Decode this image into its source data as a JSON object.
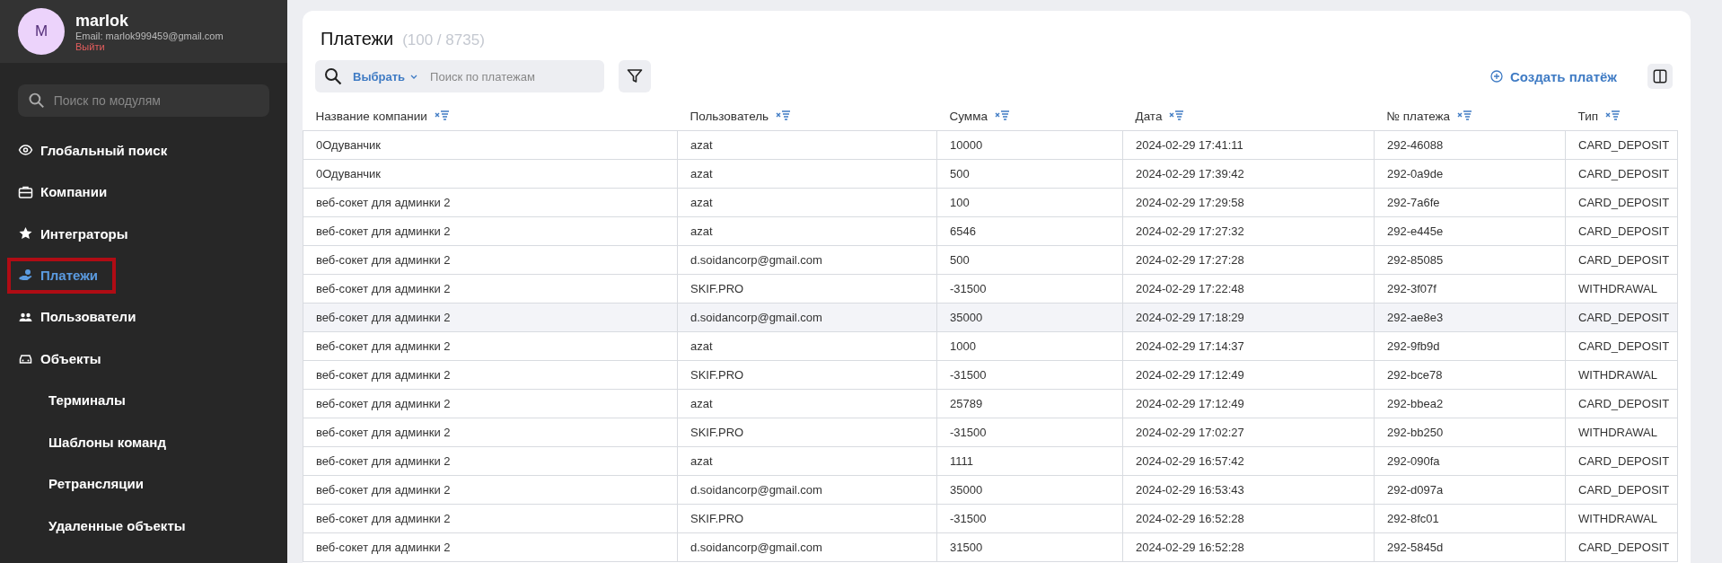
{
  "profile": {
    "avatar_letter": "M",
    "name": "marlok",
    "email": "Email: marlok999459@gmail.com",
    "logout": "Выйти"
  },
  "module_search": {
    "placeholder": "Поиск по модулям"
  },
  "nav": [
    {
      "label": "Глобальный поиск",
      "selected": false
    },
    {
      "label": "Компании",
      "selected": false
    },
    {
      "label": "Интеграторы",
      "selected": false
    },
    {
      "label": "Платежи",
      "selected": true
    },
    {
      "label": "Пользователи",
      "selected": false
    },
    {
      "label": "Объекты",
      "selected": false,
      "children": [
        {
          "label": "Терминалы",
          "selected": false
        },
        {
          "label": "Шаблоны команд",
          "selected": false
        },
        {
          "label": "Ретрансляции",
          "selected": false
        },
        {
          "label": "Удаленные объекты",
          "selected": false
        }
      ]
    }
  ],
  "page": {
    "title": "Платежи",
    "count": "(100 / 8735)"
  },
  "toolbar": {
    "select_label": "Выбрать",
    "search_placeholder": "Поиск по платежам",
    "create_button": "Создать платёж"
  },
  "table": {
    "columns": [
      "Название компании",
      "Пользователь",
      "Сумма",
      "Дата",
      "№ платежа",
      "Тип"
    ],
    "rows": [
      {
        "selected": false,
        "cells": [
          "0Одуванчик",
          "azat",
          "10000",
          "2024-02-29 17:41:11",
          "292-46088",
          "CARD_DEPOSIT"
        ]
      },
      {
        "selected": false,
        "cells": [
          "0Одуванчик",
          "azat",
          "500",
          "2024-02-29 17:39:42",
          "292-0a9de",
          "CARD_DEPOSIT"
        ]
      },
      {
        "selected": false,
        "cells": [
          "веб-сокет для админки 2",
          "azat",
          "100",
          "2024-02-29 17:29:58",
          "292-7a6fe",
          "CARD_DEPOSIT"
        ]
      },
      {
        "selected": false,
        "cells": [
          "веб-сокет для админки 2",
          "azat",
          "6546",
          "2024-02-29 17:27:32",
          "292-e445e",
          "CARD_DEPOSIT"
        ]
      },
      {
        "selected": false,
        "cells": [
          "веб-сокет для админки 2",
          "d.soidancorp@gmail.com",
          "500",
          "2024-02-29 17:27:28",
          "292-85085",
          "CARD_DEPOSIT"
        ]
      },
      {
        "selected": false,
        "cells": [
          "веб-сокет для админки 2",
          "SKIF.PRO",
          "-31500",
          "2024-02-29 17:22:48",
          "292-3f07f",
          "WITHDRAWAL"
        ]
      },
      {
        "selected": true,
        "cells": [
          "веб-сокет для админки 2",
          "d.soidancorp@gmail.com",
          "35000",
          "2024-02-29 17:18:29",
          "292-ae8e3",
          "CARD_DEPOSIT"
        ]
      },
      {
        "selected": false,
        "cells": [
          "веб-сокет для админки 2",
          "azat",
          "1000",
          "2024-02-29 17:14:37",
          "292-9fb9d",
          "CARD_DEPOSIT"
        ]
      },
      {
        "selected": false,
        "cells": [
          "веб-сокет для админки 2",
          "SKIF.PRO",
          "-31500",
          "2024-02-29 17:12:49",
          "292-bce78",
          "WITHDRAWAL"
        ]
      },
      {
        "selected": false,
        "cells": [
          "веб-сокет для админки 2",
          "azat",
          "25789",
          "2024-02-29 17:12:49",
          "292-bbea2",
          "CARD_DEPOSIT"
        ]
      },
      {
        "selected": false,
        "cells": [
          "веб-сокет для админки 2",
          "SKIF.PRO",
          "-31500",
          "2024-02-29 17:02:27",
          "292-bb250",
          "WITHDRAWAL"
        ]
      },
      {
        "selected": false,
        "cells": [
          "веб-сокет для админки 2",
          "azat",
          "1111",
          "2024-02-29 16:57:42",
          "292-090fa",
          "CARD_DEPOSIT"
        ]
      },
      {
        "selected": false,
        "cells": [
          "веб-сокет для админки 2",
          "d.soidancorp@gmail.com",
          "35000",
          "2024-02-29 16:53:43",
          "292-d097a",
          "CARD_DEPOSIT"
        ]
      },
      {
        "selected": false,
        "cells": [
          "веб-сокет для админки 2",
          "SKIF.PRO",
          "-31500",
          "2024-02-29 16:52:28",
          "292-8fc01",
          "WITHDRAWAL"
        ]
      },
      {
        "selected": false,
        "cells": [
          "веб-сокет для админки 2",
          "d.soidancorp@gmail.com",
          "31500",
          "2024-02-29 16:52:28",
          "292-5845d",
          "CARD_DEPOSIT"
        ]
      }
    ]
  }
}
